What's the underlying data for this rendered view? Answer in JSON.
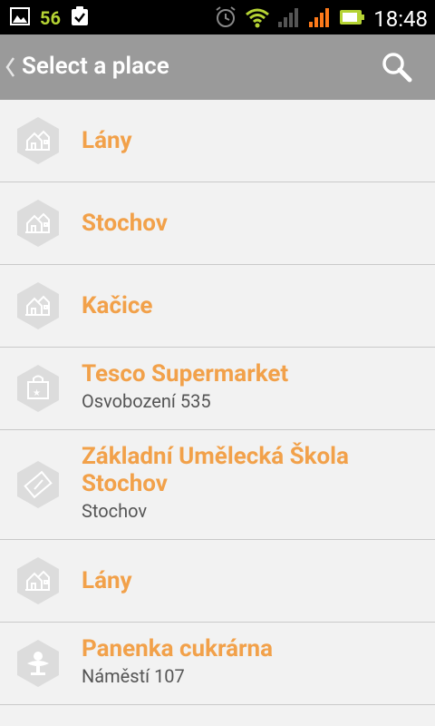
{
  "status_bar": {
    "notification_count": "56",
    "time": "18:48"
  },
  "app_bar": {
    "title": "Select a place"
  },
  "places": [
    {
      "title": "Lány",
      "subtitle": "",
      "icon": "town-icon"
    },
    {
      "title": "Stochov",
      "subtitle": "",
      "icon": "town-icon"
    },
    {
      "title": "Kačice",
      "subtitle": "",
      "icon": "town-icon"
    },
    {
      "title": "Tesco Supermarket",
      "subtitle": "Osvobození 535",
      "icon": "shopping-bag-icon"
    },
    {
      "title": "Základní Umělecká Škola Stochov",
      "subtitle": "Stochov",
      "icon": "ticket-icon"
    },
    {
      "title": "Lány",
      "subtitle": "",
      "icon": "town-icon"
    },
    {
      "title": "Panenka cukrárna",
      "subtitle": "Náměstí 107",
      "icon": "dessert-icon"
    }
  ],
  "colors": {
    "accent": "#f2a14a",
    "app_bar": "#9a9a9a",
    "icon_bg": "#dcdcdc"
  }
}
